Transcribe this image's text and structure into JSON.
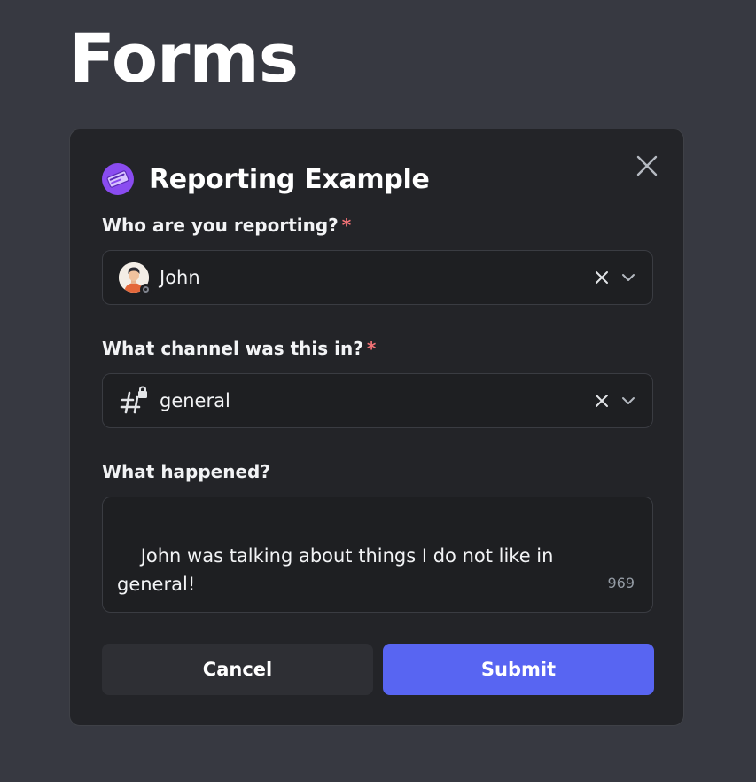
{
  "page": {
    "title": "Forms"
  },
  "modal": {
    "title": "Reporting Example",
    "app_icon": "clyde-badge-icon",
    "close_icon": "close-icon"
  },
  "fields": {
    "user": {
      "label": "Who are you reporting?",
      "required": "*",
      "value": "John",
      "status": "offline"
    },
    "channel": {
      "label": "What channel was this in?",
      "required": "*",
      "value": "general",
      "icon": "locked-channel-icon"
    },
    "details": {
      "label": "What happened?",
      "value": "John was talking about things I do not like in\ngeneral!",
      "remaining": "969"
    }
  },
  "actions": {
    "cancel_label": "Cancel",
    "submit_label": "Submit"
  },
  "colors": {
    "background": "#373941",
    "modal": "#232428",
    "input": "#1e1f22",
    "accent": "#5865f2",
    "required": "#f57377"
  }
}
